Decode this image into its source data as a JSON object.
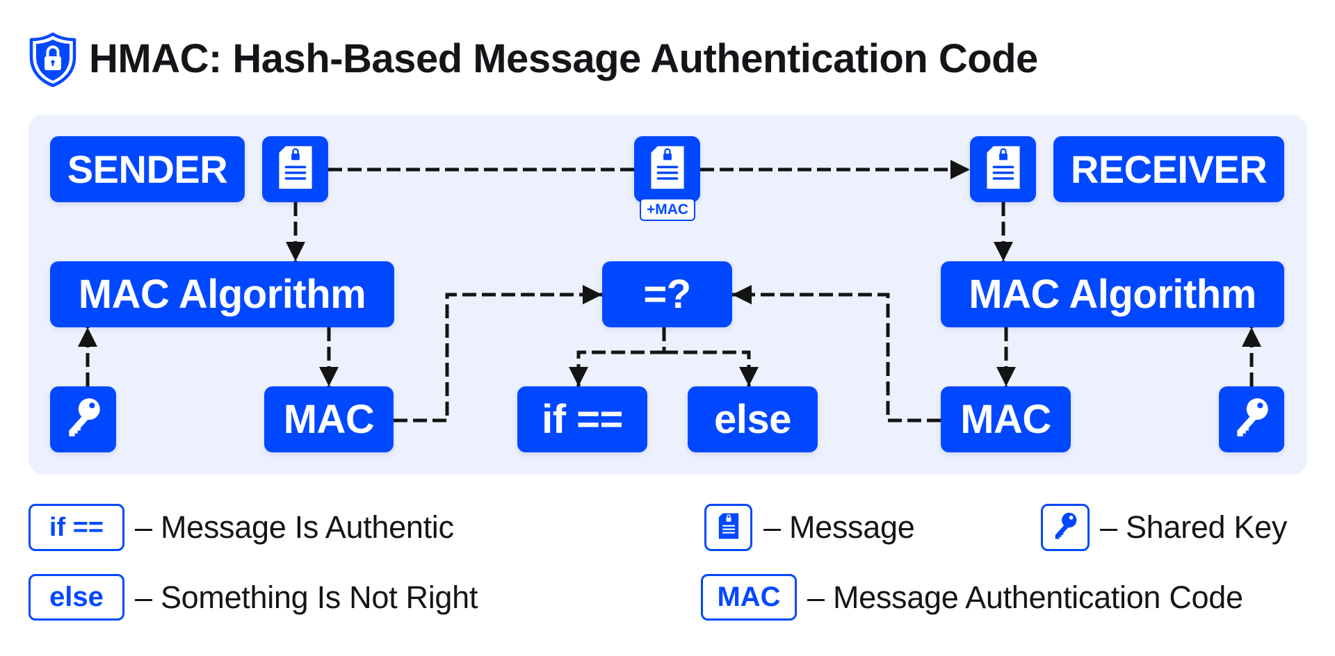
{
  "title": "HMAC: Hash-Based Message Authentication Code",
  "title_icon": "shield-lock-icon",
  "colors": {
    "accent": "#0048ff",
    "panel_background": "#edf1fd",
    "text": "#141519",
    "connector": "#141414"
  },
  "diagram": {
    "sender_label": "SENDER",
    "receiver_label": "RECEIVER",
    "sender_message_icon": "document-lock-icon",
    "transit_message_icon": "document-lock-icon",
    "transit_badge": "+MAC",
    "receiver_message_icon": "document-lock-icon",
    "sender_algorithm_label": "MAC Algorithm",
    "receiver_algorithm_label": "MAC Algorithm",
    "sender_key_icon": "key-icon",
    "receiver_key_icon": "key-icon",
    "sender_mac_label": "MAC",
    "receiver_mac_label": "MAC",
    "compare_label": "=?",
    "match_label": "if ==",
    "mismatch_label": "else",
    "flows": [
      {
        "from": "sender-message",
        "to": "receiver-message",
        "via": "transit-message"
      },
      {
        "from": "sender-message",
        "to": "sender-mac-algorithm"
      },
      {
        "from": "sender-key",
        "to": "sender-mac-algorithm"
      },
      {
        "from": "sender-mac-algorithm",
        "to": "sender-mac"
      },
      {
        "from": "sender-mac",
        "to": "compare"
      },
      {
        "from": "receiver-message",
        "to": "receiver-mac-algorithm"
      },
      {
        "from": "receiver-key",
        "to": "receiver-mac-algorithm"
      },
      {
        "from": "receiver-mac-algorithm",
        "to": "receiver-mac"
      },
      {
        "from": "receiver-mac",
        "to": "compare"
      },
      {
        "from": "compare",
        "to": "match"
      },
      {
        "from": "compare",
        "to": "mismatch"
      }
    ]
  },
  "legend": {
    "items": [
      {
        "symbol": "if ==",
        "dash": "–",
        "text": "Message Is Authentic"
      },
      {
        "symbol": "else",
        "dash": "–",
        "text": "Something Is Not Right"
      },
      {
        "icon": "document-lock-icon",
        "dash": "–",
        "text": "Message"
      },
      {
        "icon": "key-icon",
        "dash": "–",
        "text": "Shared Key"
      },
      {
        "symbol": "MAC",
        "dash": "–",
        "text": "Message Authentication Code"
      }
    ]
  }
}
